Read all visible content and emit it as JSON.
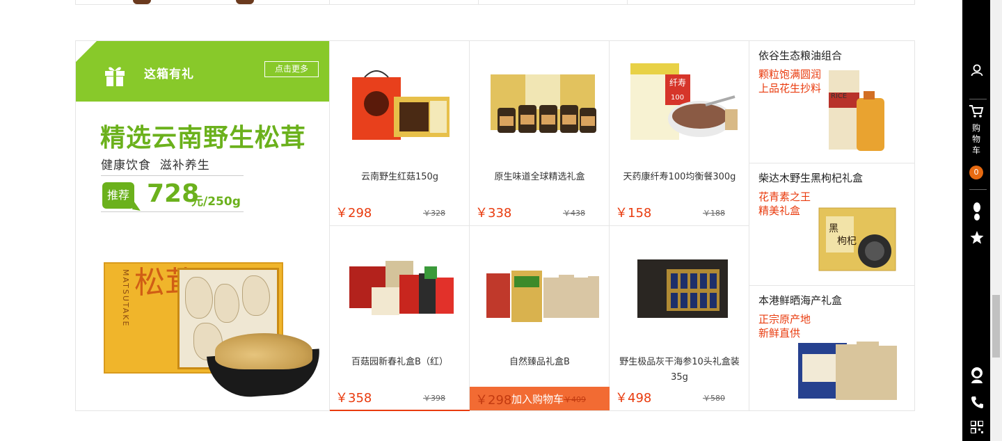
{
  "floor": {
    "title": "这箱有礼",
    "more_label": "点击更多",
    "headline": "精选云南野生松茸",
    "subline": "健康饮食  滋补养生",
    "badge": "推荐",
    "price_number": "728",
    "price_unit": "元/250g",
    "box_kanji": "松茸",
    "box_vertical": "MATSUTAKE"
  },
  "products": [
    {
      "name": "云南野生红菇150g",
      "price": "￥298",
      "old_price": "￥328"
    },
    {
      "name": "原生味道全球精选礼盒",
      "price": "￥338",
      "old_price": "￥438"
    },
    {
      "name": "天药康纤寿100均衡餐300g",
      "price": "￥158",
      "old_price": "￥188"
    },
    {
      "name": "百菇园新春礼盒B（红）",
      "price": "￥358",
      "old_price": "￥398"
    },
    {
      "name": "自然臻品礼盒B",
      "price": "￥298",
      "old_price": "￥409",
      "cart_label": "加入购物车"
    },
    {
      "name": "野生极品灰干海参10头礼盒装35g",
      "price": "￥498",
      "old_price": "￥580"
    }
  ],
  "featured": [
    {
      "name": "依谷生态粮油组合",
      "line1": "颗粒饱满圆润",
      "line2": "上品花生抄料"
    },
    {
      "name": "柴达木野生黑枸杞礼盒",
      "line1": "花青素之王",
      "line2": "精美礼盒"
    },
    {
      "name": "本港鲜晒海产礼盒",
      "line1": "正宗原产地",
      "line2": "新鲜直供"
    }
  ],
  "sidebar": {
    "cart_label": "购物车",
    "cart_count": "0",
    "icons": [
      "user-icon",
      "cart-icon",
      "footprint-icon",
      "star-icon",
      "service-icon",
      "phone-icon",
      "qrcode-icon"
    ]
  },
  "colors": {
    "green": "#88c92a",
    "dark_green": "#6bb11c",
    "price_red": "#e93b0e",
    "cart_orange": "#f26b33",
    "badge_orange": "#e76a11"
  }
}
